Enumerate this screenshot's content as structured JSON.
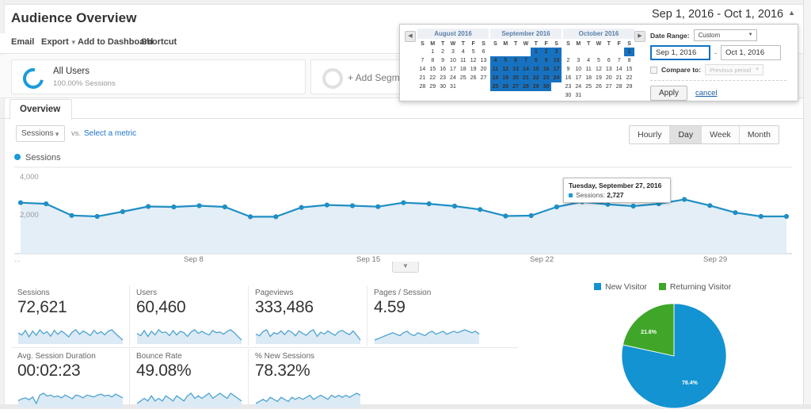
{
  "header": {
    "title": "Audience Overview",
    "toolbar": {
      "email": "Email",
      "export": "Export",
      "add_to_dashboard": "Add to Dashboard",
      "shortcut": "Shortcut"
    }
  },
  "segments": {
    "all_users": {
      "name": "All Users",
      "sub": "100.00% Sessions"
    },
    "add_segment": "+ Add Segment"
  },
  "tabs": [
    {
      "label": "Overview",
      "active": true
    }
  ],
  "metric_selector": {
    "selected": "Sessions",
    "vs": "vs.",
    "select_a_metric": "Select a metric"
  },
  "granularity": {
    "options": [
      "Hourly",
      "Day",
      "Week",
      "Month"
    ],
    "selected": "Day"
  },
  "chart_legend": "Sessions",
  "tooltip": {
    "date": "Tuesday, September 27, 2016",
    "metric_label": "Sessions:",
    "metric_value": "2,727"
  },
  "date_range": {
    "display": "Sep 1, 2016 - Oct 1, 2016",
    "label": "Date Range:",
    "preset": "Custom",
    "start": "Sep 1, 2016",
    "end": "Oct 1, 2016",
    "dash": "-",
    "compare_label": "Compare to:",
    "compare_value": "Previous period",
    "apply": "Apply",
    "cancel": "cancel",
    "weekday_headers": [
      "S",
      "M",
      "T",
      "W",
      "T",
      "F",
      "S"
    ],
    "calendars": [
      {
        "title": "August 2016",
        "weeks": [
          [
            {
              "d": "",
              "s": "empty"
            },
            {
              "d": "1",
              "s": "semi"
            },
            {
              "d": "2",
              "s": "semi"
            },
            {
              "d": "3",
              "s": "semi"
            },
            {
              "d": "4",
              "s": "semi"
            },
            {
              "d": "5",
              "s": "semi"
            },
            {
              "d": "6",
              "s": "semi"
            }
          ],
          [
            {
              "d": "7",
              "s": "semi"
            },
            {
              "d": "8",
              "s": "semi"
            },
            {
              "d": "9",
              "s": "semi"
            },
            {
              "d": "10",
              "s": "semi"
            },
            {
              "d": "11",
              "s": "semi"
            },
            {
              "d": "12",
              "s": "semi"
            },
            {
              "d": "13",
              "s": "semi"
            }
          ],
          [
            {
              "d": "14",
              "s": "semi"
            },
            {
              "d": "15",
              "s": "semi"
            },
            {
              "d": "16",
              "s": "semi"
            },
            {
              "d": "17",
              "s": "semi"
            },
            {
              "d": "18",
              "s": "semi"
            },
            {
              "d": "19",
              "s": "semi"
            },
            {
              "d": "20",
              "s": "semi"
            }
          ],
          [
            {
              "d": "21",
              "s": "semi"
            },
            {
              "d": "22",
              "s": "semi"
            },
            {
              "d": "23",
              "s": "semi"
            },
            {
              "d": "24",
              "s": "semi"
            },
            {
              "d": "25",
              "s": "semi"
            },
            {
              "d": "26",
              "s": "semi"
            },
            {
              "d": "27",
              "s": "semi"
            }
          ],
          [
            {
              "d": "28",
              "s": "semi"
            },
            {
              "d": "29",
              "s": "semi"
            },
            {
              "d": "30",
              "s": "semi"
            },
            {
              "d": "31",
              "s": "semi"
            },
            {
              "d": "",
              "s": "empty"
            },
            {
              "d": "",
              "s": "empty"
            },
            {
              "d": "",
              "s": "empty"
            }
          ]
        ]
      },
      {
        "title": "September 2016",
        "weeks": [
          [
            {
              "d": "",
              "s": "empty"
            },
            {
              "d": "",
              "s": "empty"
            },
            {
              "d": "",
              "s": "empty"
            },
            {
              "d": "",
              "s": "empty"
            },
            {
              "d": "1",
              "s": "sel"
            },
            {
              "d": "2",
              "s": "sel"
            },
            {
              "d": "3",
              "s": "sel"
            }
          ],
          [
            {
              "d": "4",
              "s": "sel"
            },
            {
              "d": "5",
              "s": "sel"
            },
            {
              "d": "6",
              "s": "sel"
            },
            {
              "d": "7",
              "s": "sel"
            },
            {
              "d": "8",
              "s": "sel"
            },
            {
              "d": "9",
              "s": "sel"
            },
            {
              "d": "10",
              "s": "sel"
            }
          ],
          [
            {
              "d": "11",
              "s": "sel"
            },
            {
              "d": "12",
              "s": "sel"
            },
            {
              "d": "13",
              "s": "sel"
            },
            {
              "d": "14",
              "s": "sel"
            },
            {
              "d": "15",
              "s": "sel"
            },
            {
              "d": "16",
              "s": "sel"
            },
            {
              "d": "17",
              "s": "sel"
            }
          ],
          [
            {
              "d": "18",
              "s": "sel"
            },
            {
              "d": "19",
              "s": "sel"
            },
            {
              "d": "20",
              "s": "sel"
            },
            {
              "d": "21",
              "s": "sel"
            },
            {
              "d": "22",
              "s": "sel"
            },
            {
              "d": "23",
              "s": "sel"
            },
            {
              "d": "24",
              "s": "sel"
            }
          ],
          [
            {
              "d": "25",
              "s": "sel"
            },
            {
              "d": "26",
              "s": "sel"
            },
            {
              "d": "27",
              "s": "sel"
            },
            {
              "d": "28",
              "s": "sel"
            },
            {
              "d": "29",
              "s": "sel"
            },
            {
              "d": "30",
              "s": "sel"
            },
            {
              "d": "",
              "s": "empty"
            }
          ]
        ]
      },
      {
        "title": "October 2016",
        "weeks": [
          [
            {
              "d": "",
              "s": "empty"
            },
            {
              "d": "",
              "s": "empty"
            },
            {
              "d": "",
              "s": "empty"
            },
            {
              "d": "",
              "s": "empty"
            },
            {
              "d": "",
              "s": "empty"
            },
            {
              "d": "",
              "s": "empty"
            },
            {
              "d": "1",
              "s": "sel"
            }
          ],
          [
            {
              "d": "2",
              "s": "semi"
            },
            {
              "d": "3",
              "s": "semi"
            },
            {
              "d": "4",
              "s": "dim"
            },
            {
              "d": "5",
              "s": "dim"
            },
            {
              "d": "6",
              "s": "dim"
            },
            {
              "d": "7",
              "s": "dim"
            },
            {
              "d": "8",
              "s": "dim"
            }
          ],
          [
            {
              "d": "9",
              "s": "dim"
            },
            {
              "d": "10",
              "s": "dim"
            },
            {
              "d": "11",
              "s": "dim"
            },
            {
              "d": "12",
              "s": "dim"
            },
            {
              "d": "13",
              "s": "dim"
            },
            {
              "d": "14",
              "s": "dim"
            },
            {
              "d": "15",
              "s": "dim"
            }
          ],
          [
            {
              "d": "16",
              "s": "dim"
            },
            {
              "d": "17",
              "s": "dim"
            },
            {
              "d": "18",
              "s": "dim"
            },
            {
              "d": "19",
              "s": "dim"
            },
            {
              "d": "20",
              "s": "dim"
            },
            {
              "d": "21",
              "s": "dim"
            },
            {
              "d": "22",
              "s": "dim"
            }
          ],
          [
            {
              "d": "23",
              "s": "dim"
            },
            {
              "d": "24",
              "s": "dim"
            },
            {
              "d": "25",
              "s": "dim"
            },
            {
              "d": "26",
              "s": "dim"
            },
            {
              "d": "27",
              "s": "dim"
            },
            {
              "d": "28",
              "s": "dim"
            },
            {
              "d": "29",
              "s": "dim"
            }
          ],
          [
            {
              "d": "30",
              "s": "dim"
            },
            {
              "d": "31",
              "s": "dim"
            },
            {
              "d": "",
              "s": "empty"
            },
            {
              "d": "",
              "s": "empty"
            },
            {
              "d": "",
              "s": "empty"
            },
            {
              "d": "",
              "s": "empty"
            },
            {
              "d": "",
              "s": "empty"
            }
          ]
        ]
      }
    ]
  },
  "metric_cards": [
    {
      "label": "Sessions",
      "value": "72,621"
    },
    {
      "label": "Users",
      "value": "60,460"
    },
    {
      "label": "Pageviews",
      "value": "333,486"
    },
    {
      "label": "Pages / Session",
      "value": "4.59"
    },
    {
      "label": "Avg. Session Duration",
      "value": "00:02:23"
    },
    {
      "label": "Bounce Rate",
      "value": "49.08%"
    },
    {
      "label": "% New Sessions",
      "value": "78.32%"
    }
  ],
  "colors": {
    "accent_blue": "#1b9bd8",
    "line_blue": "#1f8fc4",
    "pie_blue": "#1393d1",
    "pie_green": "#40a62a",
    "selected_day": "#1672c1",
    "link": "#1a73c8"
  },
  "chart_data": {
    "type": "line",
    "title": "Sessions",
    "xlabel": "",
    "ylabel": "Sessions",
    "ylim": [
      0,
      4000
    ],
    "yticks": [
      2000,
      4000
    ],
    "ytick_labels": [
      "2,000",
      "4,000"
    ],
    "grid": false,
    "legend": [
      "Sessions"
    ],
    "legend_position": "top-left",
    "xtick_labels": [
      "Sep 8",
      "Sep 15",
      "Sep 22",
      "Sep 29"
    ],
    "x": [
      "Sep 1",
      "Sep 2",
      "Sep 3",
      "Sep 4",
      "Sep 5",
      "Sep 6",
      "Sep 7",
      "Sep 8",
      "Sep 9",
      "Sep 10",
      "Sep 11",
      "Sep 12",
      "Sep 13",
      "Sep 14",
      "Sep 15",
      "Sep 16",
      "Sep 17",
      "Sep 18",
      "Sep 19",
      "Sep 20",
      "Sep 21",
      "Sep 22",
      "Sep 23",
      "Sep 24",
      "Sep 25",
      "Sep 26",
      "Sep 27",
      "Sep 28",
      "Sep 29",
      "Sep 30",
      "Oct 1"
    ],
    "values": [
      2680,
      2620,
      2010,
      1960,
      2210,
      2480,
      2460,
      2520,
      2460,
      1940,
      1940,
      2430,
      2560,
      2520,
      2470,
      2680,
      2620,
      2500,
      2320,
      1980,
      2000,
      2460,
      2727,
      2590,
      2500,
      2620,
      2850,
      2530,
      2160,
      1960,
      1960
    ],
    "annotation": {
      "x": "Sep 27",
      "date": "Tuesday, September 27, 2016",
      "label": "Sessions:",
      "value": "2,727"
    }
  },
  "pie_chart": {
    "type": "pie",
    "title": "",
    "legend": [
      "New Visitor",
      "Returning Visitor"
    ],
    "labels": [
      "New Visitor",
      "Returning Visitor"
    ],
    "values": [
      78.4,
      21.6
    ],
    "value_labels": [
      "78.4%",
      "21.6%"
    ],
    "colors": [
      "#1393d1",
      "#40a62a"
    ]
  },
  "sparklines": {
    "sessions": [
      52,
      46,
      60,
      40,
      58,
      45,
      62,
      50,
      56,
      42,
      60,
      48,
      58,
      50,
      40,
      55,
      62,
      48,
      58,
      52,
      44,
      60,
      50,
      56,
      46,
      58,
      62,
      50,
      40,
      30
    ],
    "users": [
      50,
      44,
      58,
      42,
      56,
      46,
      60,
      52,
      54,
      44,
      58,
      46,
      56,
      52,
      42,
      54,
      60,
      50,
      56,
      50,
      46,
      58,
      52,
      54,
      48,
      56,
      60,
      52,
      42,
      32
    ],
    "pageviews": [
      48,
      42,
      56,
      62,
      40,
      52,
      48,
      58,
      46,
      60,
      54,
      42,
      58,
      50,
      44,
      56,
      62,
      40,
      54,
      48,
      58,
      50,
      44,
      56,
      60,
      52,
      46,
      58,
      44,
      28
    ],
    "pages_session": [
      44,
      46,
      48,
      50,
      52,
      54,
      52,
      50,
      54,
      56,
      52,
      50,
      54,
      52,
      50,
      54,
      56,
      52,
      54,
      56,
      52,
      54,
      56,
      54,
      56,
      58,
      56,
      54,
      56,
      52
    ],
    "avg_duration": [
      40,
      44,
      46,
      42,
      48,
      34,
      52,
      56,
      50,
      52,
      48,
      50,
      46,
      52,
      48,
      44,
      52,
      50,
      46,
      52,
      50,
      48,
      52,
      54,
      50,
      52,
      48,
      54,
      50,
      46
    ],
    "bounce_rate": [
      48,
      50,
      52,
      50,
      54,
      50,
      52,
      50,
      54,
      52,
      50,
      54,
      52,
      50,
      54,
      56,
      52,
      54,
      52,
      54,
      56,
      52,
      54,
      56,
      54,
      52,
      56,
      54,
      52,
      50
    ],
    "new_sessions": [
      50,
      52,
      54,
      52,
      56,
      54,
      52,
      56,
      54,
      52,
      56,
      54,
      56,
      54,
      56,
      58,
      54,
      56,
      58,
      56,
      54,
      58,
      56,
      58,
      56,
      58,
      56,
      58,
      60,
      58
    ]
  },
  "chart_handle_icon": "chevron-down-icon"
}
